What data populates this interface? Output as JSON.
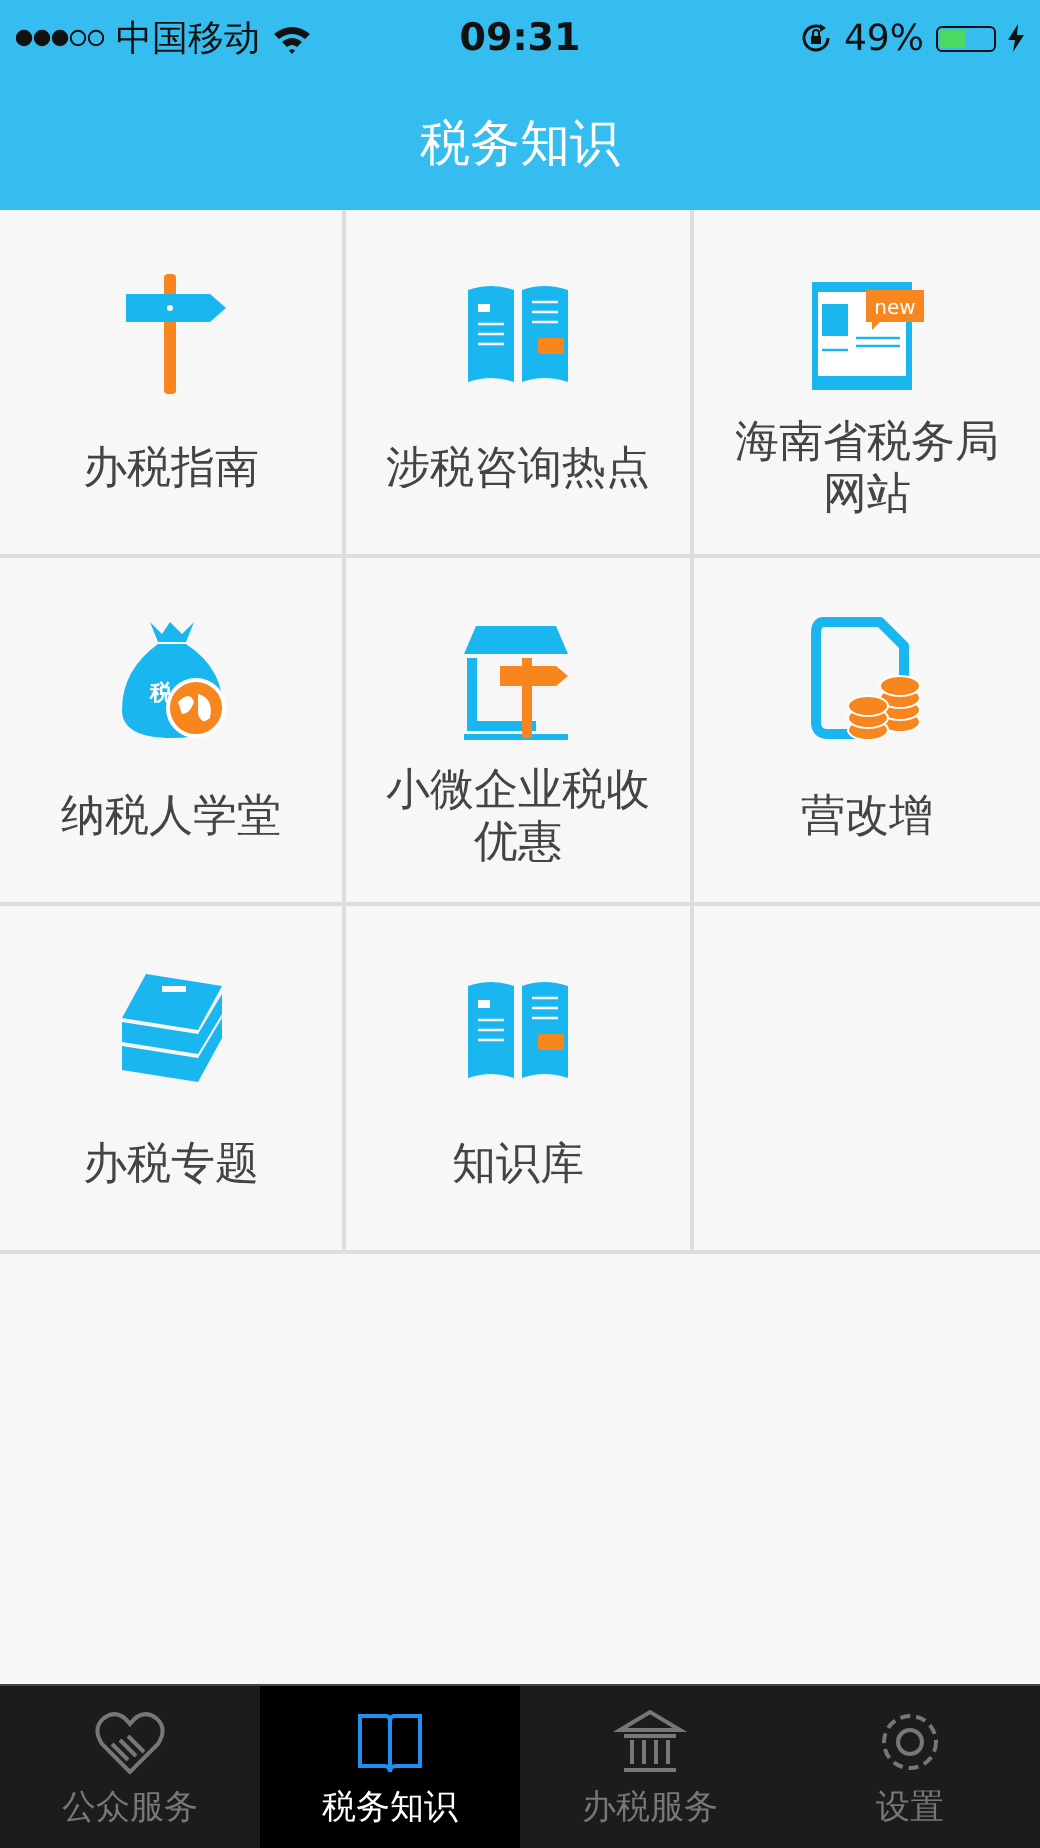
{
  "status_bar": {
    "carrier": "中国移动",
    "time": "09:31",
    "battery_text": "49%",
    "battery": {
      "level": 0.49
    },
    "charging": true
  },
  "nav_bar": {
    "title": "税务知识"
  },
  "grid": [
    {
      "label": "办税指南",
      "kind": "signpost"
    },
    {
      "label": "涉税咨询热点",
      "kind": "book"
    },
    {
      "label": "海南省税务局网站",
      "kind": "webpage",
      "badge": "new"
    },
    {
      "label": "纳税人学堂",
      "kind": "moneybag",
      "badge": "税"
    },
    {
      "label": "小微企业税收优惠",
      "kind": "shop"
    },
    {
      "label": "营改增",
      "kind": "coins"
    },
    {
      "label": "办税专题",
      "kind": "books"
    },
    {
      "label": "知识库",
      "kind": "book"
    }
  ],
  "tab_bar": [
    {
      "label": "公众服务",
      "kind": "heart",
      "selected": false
    },
    {
      "label": "税务知识",
      "kind": "book",
      "selected": true
    },
    {
      "label": "办税服务",
      "kind": "bank",
      "selected": false
    },
    {
      "label": "设置",
      "kind": "gear",
      "selected": false
    }
  ]
}
